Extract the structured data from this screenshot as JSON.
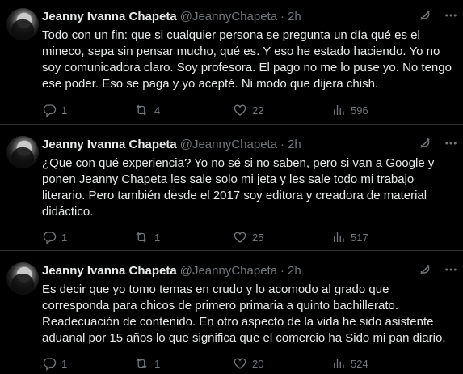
{
  "tweets": [
    {
      "author_name": "Jeanny Ivanna Chapeta",
      "handle": "@JeannyChapeta",
      "separator": "·",
      "time": "2h",
      "text": "Todo con un fin: que si cualquier persona se pregunta un día qué es el mineco, sepa sin pensar mucho, qué es. Y eso he estado haciendo. Yo no soy comunicadora claro. Soy profesora. El pago no me lo puse yo. No tengo ese poder. Eso se paga y yo acepté. Ni modo que dijera chish.",
      "replies": "1",
      "retweets": "4",
      "likes": "22",
      "views": "596"
    },
    {
      "author_name": "Jeanny Ivanna Chapeta",
      "handle": "@JeannyChapeta",
      "separator": "·",
      "time": "2h",
      "text": "¿Que con qué experiencia? Yo no sé si no saben, pero si van a Google y ponen Jeanny Chapeta les sale solo mi jeta y les sale todo mi trabajo literario. Pero también desde el 2017 soy editora y creadora de material didáctico.",
      "replies": "1",
      "retweets": "1",
      "likes": "25",
      "views": "517"
    },
    {
      "author_name": "Jeanny Ivanna Chapeta",
      "handle": "@JeannyChapeta",
      "separator": "·",
      "time": "2h",
      "text": "Es decir que yo tomo temas en crudo y lo acomodo al grado que corresponda para chicos de primero primaria a quinto bachillerato. Readecuación de contenido. En otro aspecto de la vida he sido asistente aduanal por 15 años lo que significa que el comercio ha Sido mi pan diario.",
      "replies": "1",
      "retweets": "1",
      "likes": "20",
      "views": "524"
    }
  ],
  "icons": {
    "grok": "grok-icon",
    "more": "more-icon",
    "reply": "reply-icon",
    "retweet": "retweet-icon",
    "like": "heart-icon",
    "views": "views-icon"
  },
  "colors": {
    "background": "#000000",
    "text": "#e7e9ea",
    "muted": "#71767b",
    "divider": "#2f3336"
  }
}
